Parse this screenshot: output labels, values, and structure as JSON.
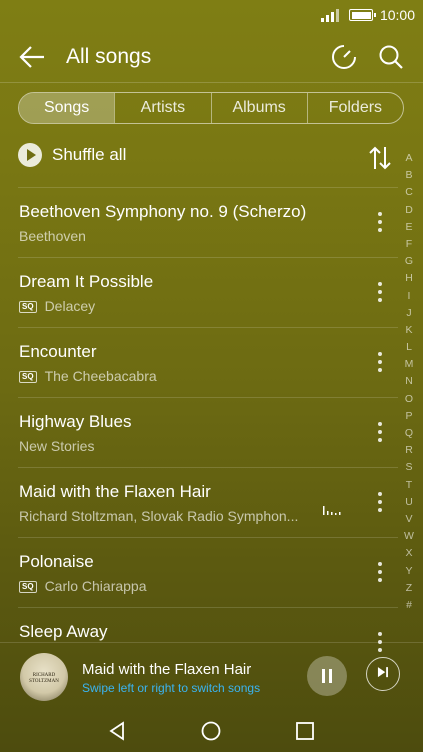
{
  "status": {
    "time": "10:00"
  },
  "appbar": {
    "title": "All songs"
  },
  "tabs": [
    {
      "label": "Songs",
      "active": true
    },
    {
      "label": "Artists"
    },
    {
      "label": "Albums"
    },
    {
      "label": "Folders"
    }
  ],
  "shuffle": {
    "label": "Shuffle all"
  },
  "alphabet": [
    "A",
    "B",
    "C",
    "D",
    "E",
    "F",
    "G",
    "H",
    "I",
    "J",
    "K",
    "L",
    "M",
    "N",
    "O",
    "P",
    "Q",
    "R",
    "S",
    "T",
    "U",
    "V",
    "W",
    "X",
    "Y",
    "Z",
    "#"
  ],
  "songs": [
    {
      "title": "Beethoven Symphony no. 9 (Scherzo)",
      "artist": "Beethoven",
      "sq": false
    },
    {
      "title": "Dream It Possible",
      "artist": "Delacey",
      "sq": true
    },
    {
      "title": "Encounter",
      "artist": "The Cheebacabra",
      "sq": true
    },
    {
      "title": "Highway Blues",
      "artist": "New Stories",
      "sq": false
    },
    {
      "title": "Maid with the Flaxen Hair",
      "artist": "Richard Stoltzman, Slovak Radio Symphon...",
      "sq": false,
      "playing": true
    },
    {
      "title": "Polonaise",
      "artist": "Carlo Chiarappa",
      "sq": true
    },
    {
      "title": "Sleep Away",
      "artist": "",
      "sq": false
    }
  ],
  "sq_label": "SQ",
  "player": {
    "title": "Maid with the Flaxen Hair",
    "hint": "Swipe left or right to switch songs",
    "cover_text": "RICHARD STOLTZMAN",
    "hint_color": "#3ab4f2"
  },
  "icons": {
    "back": "back-arrow-icon",
    "sleep_timer": "timer-icon",
    "search": "search-icon",
    "sort": "sort-icon",
    "more": "more-vert-icon",
    "pause": "pause-icon",
    "next": "skip-next-icon",
    "nav_back": "triangle-back-icon",
    "nav_home": "circle-home-icon",
    "nav_recents": "square-recents-icon"
  }
}
